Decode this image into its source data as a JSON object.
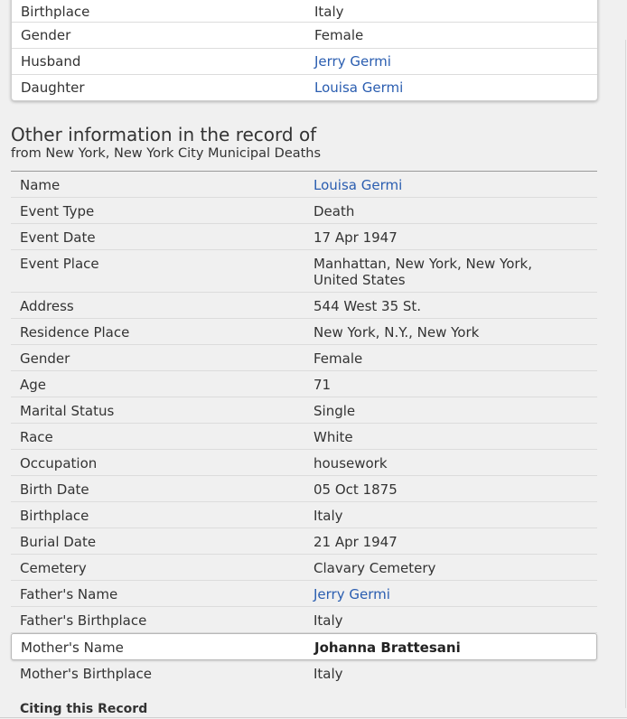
{
  "top_card": {
    "rows": [
      {
        "label": "Birthplace",
        "value": "Italy",
        "link": false
      },
      {
        "label": "Gender",
        "value": "Female",
        "link": false
      },
      {
        "label": "Husband",
        "value": "Jerry Germi",
        "link": true
      },
      {
        "label": "Daughter",
        "value": "Louisa Germi",
        "link": true
      }
    ]
  },
  "section": {
    "heading": "Other information in the record of",
    "subheading": "from New York, New York City Municipal Deaths"
  },
  "record": {
    "rows": [
      {
        "label": "Name",
        "value": "Louisa Germi",
        "link": true
      },
      {
        "label": "Event Type",
        "value": "Death",
        "link": false
      },
      {
        "label": "Event Date",
        "value": "17 Apr 1947",
        "link": false
      },
      {
        "label": "Event Place",
        "value": "Manhattan, New York, New York, United States",
        "link": false
      },
      {
        "label": "Address",
        "value": "544 West 35 St.",
        "link": false
      },
      {
        "label": "Residence Place",
        "value": "New York, N.Y., New York",
        "link": false
      },
      {
        "label": "Gender",
        "value": "Female",
        "link": false
      },
      {
        "label": "Age",
        "value": "71",
        "link": false
      },
      {
        "label": "Marital Status",
        "value": "Single",
        "link": false
      },
      {
        "label": "Race",
        "value": "White",
        "link": false
      },
      {
        "label": "Occupation",
        "value": "housework",
        "link": false
      },
      {
        "label": "Birth Date",
        "value": "05 Oct 1875",
        "link": false
      },
      {
        "label": "Birthplace",
        "value": "Italy",
        "link": false
      },
      {
        "label": "Burial Date",
        "value": "21 Apr 1947",
        "link": false
      },
      {
        "label": "Cemetery",
        "value": "Clavary Cemetery",
        "link": false
      },
      {
        "label": "Father's Name",
        "value": "Jerry Germi",
        "link": true
      },
      {
        "label": "Father's Birthplace",
        "value": "Italy",
        "link": false
      },
      {
        "label": "Mother's Name",
        "value": "Johanna Brattesani",
        "link": false,
        "highlight": true
      },
      {
        "label": "Mother's Birthplace",
        "value": "Italy",
        "link": false
      }
    ]
  },
  "citing_label": "Citing this Record",
  "colors": {
    "link": "#2a5db0",
    "text": "#333333",
    "background": "#f0f0f0"
  }
}
